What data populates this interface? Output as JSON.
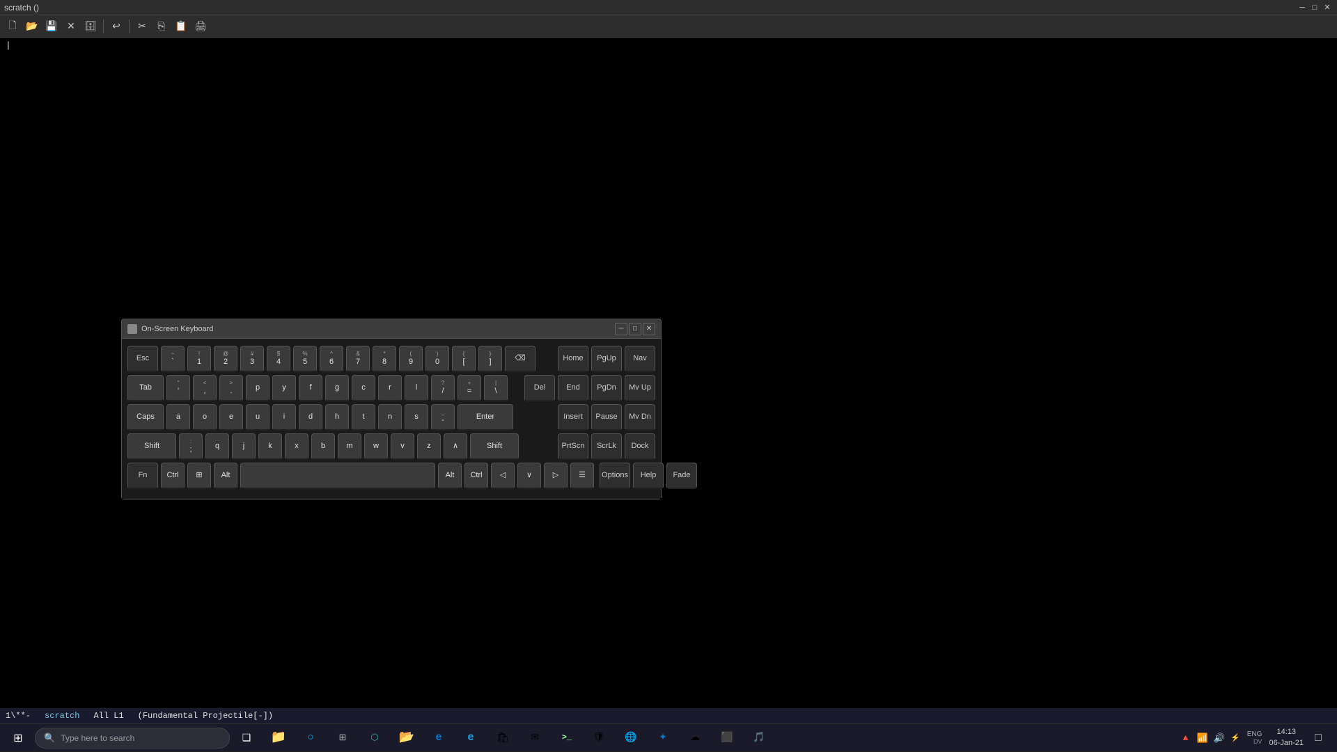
{
  "window": {
    "title": "scratch ()",
    "app_name": "scratch"
  },
  "toolbar": {
    "buttons": [
      {
        "name": "new-file",
        "icon": "🗋",
        "label": "New"
      },
      {
        "name": "open-file",
        "icon": "📂",
        "label": "Open"
      },
      {
        "name": "save-file",
        "icon": "💾",
        "label": "Save"
      },
      {
        "name": "close-file",
        "icon": "✕",
        "label": "Close"
      },
      {
        "name": "save-as",
        "icon": "🗄",
        "label": "Save As"
      },
      {
        "name": "undo",
        "icon": "↩",
        "label": "Undo"
      },
      {
        "name": "cut",
        "icon": "✂",
        "label": "Cut"
      },
      {
        "name": "copy",
        "icon": "⎘",
        "label": "Copy"
      },
      {
        "name": "paste",
        "icon": "📋",
        "label": "Paste"
      },
      {
        "name": "print",
        "icon": "🖨",
        "label": "Print"
      }
    ]
  },
  "osk": {
    "title": "On-Screen Keyboard",
    "rows": [
      {
        "keys": [
          {
            "main": "Esc",
            "top": "",
            "wide": false
          },
          {
            "main": "`",
            "top": "~",
            "wide": false
          },
          {
            "main": "1",
            "top": "!",
            "wide": false
          },
          {
            "main": "2",
            "top": "@",
            "wide": false
          },
          {
            "main": "3",
            "top": "#",
            "wide": false
          },
          {
            "main": "4",
            "top": "$",
            "wide": false
          },
          {
            "main": "5",
            "top": "%",
            "wide": false
          },
          {
            "main": "6",
            "top": "^",
            "wide": false
          },
          {
            "main": "7",
            "top": "&",
            "wide": false
          },
          {
            "main": "8",
            "top": "*",
            "wide": false
          },
          {
            "main": "9",
            "top": "(",
            "wide": false
          },
          {
            "main": "0",
            "top": ")",
            "wide": false
          },
          {
            "main": "[",
            "top": "{",
            "wide": false
          },
          {
            "main": "]",
            "top": "}",
            "wide": false
          },
          {
            "main": "⌫",
            "top": "",
            "wide": true,
            "special": true
          },
          {
            "main": "Home",
            "top": "",
            "wide": false,
            "special": true
          },
          {
            "main": "PgUp",
            "top": "",
            "wide": false,
            "special": true
          },
          {
            "main": "Nav",
            "top": "",
            "wide": false,
            "special": true
          }
        ]
      },
      {
        "keys": [
          {
            "main": "Tab",
            "top": "",
            "wide": true,
            "special": false
          },
          {
            "main": "\"",
            "top": "",
            "wide": false
          },
          {
            "main": "<",
            "top": "",
            "wide": false
          },
          {
            "main": ">",
            "top": "",
            "wide": false
          },
          {
            "main": "p",
            "top": "",
            "wide": false
          },
          {
            "main": "y",
            "top": "",
            "wide": false
          },
          {
            "main": "f",
            "top": "",
            "wide": false
          },
          {
            "main": "g",
            "top": "",
            "wide": false
          },
          {
            "main": "c",
            "top": "",
            "wide": false
          },
          {
            "main": "r",
            "top": "",
            "wide": false
          },
          {
            "main": "l",
            "top": "",
            "wide": false
          },
          {
            "main": "?",
            "top": "",
            "wide": false
          },
          {
            "main": "/",
            "top": "",
            "wide": false
          },
          {
            "main": "+",
            "top": "",
            "wide": false
          },
          {
            "main": "=",
            "top": "",
            "wide": false
          },
          {
            "main": "\\",
            "top": "",
            "wide": false
          },
          {
            "main": "Del",
            "top": "",
            "wide": false,
            "special": true
          },
          {
            "main": "End",
            "top": "",
            "wide": false,
            "special": true
          },
          {
            "main": "PgDn",
            "top": "",
            "wide": false,
            "special": true
          },
          {
            "main": "Mv Up",
            "top": "",
            "wide": false,
            "special": true
          }
        ]
      },
      {
        "keys": [
          {
            "main": "Caps",
            "top": "",
            "wide": true,
            "special": false
          },
          {
            "main": "a",
            "top": "",
            "wide": false
          },
          {
            "main": "o",
            "top": "",
            "wide": false
          },
          {
            "main": "e",
            "top": "",
            "wide": false
          },
          {
            "main": "u",
            "top": "",
            "wide": false
          },
          {
            "main": "i",
            "top": "",
            "wide": false
          },
          {
            "main": "d",
            "top": "",
            "wide": false
          },
          {
            "main": "h",
            "top": "",
            "wide": false
          },
          {
            "main": "t",
            "top": "",
            "wide": false
          },
          {
            "main": "n",
            "top": "",
            "wide": false
          },
          {
            "main": "s",
            "top": "",
            "wide": false
          },
          {
            "main": "_",
            "top": "-",
            "wide": false
          },
          {
            "main": "Enter",
            "top": "",
            "wide": true,
            "special": false
          },
          {
            "main": "Insert",
            "top": "",
            "wide": false,
            "special": true
          },
          {
            "main": "Pause",
            "top": "",
            "wide": false,
            "special": true
          },
          {
            "main": "Mv Dn",
            "top": "",
            "wide": false,
            "special": true
          }
        ]
      },
      {
        "keys": [
          {
            "main": "Shift",
            "top": "",
            "wide": true,
            "special": false
          },
          {
            "main": ";",
            "top": ":",
            "wide": false
          },
          {
            "main": "q",
            "top": "",
            "wide": false
          },
          {
            "main": "j",
            "top": "",
            "wide": false
          },
          {
            "main": "k",
            "top": "",
            "wide": false
          },
          {
            "main": "x",
            "top": "",
            "wide": false
          },
          {
            "main": "b",
            "top": "",
            "wide": false
          },
          {
            "main": "m",
            "top": "",
            "wide": false
          },
          {
            "main": "w",
            "top": "",
            "wide": false
          },
          {
            "main": "v",
            "top": "",
            "wide": false
          },
          {
            "main": "z",
            "top": "",
            "wide": false
          },
          {
            "main": "∧",
            "top": "",
            "wide": false
          },
          {
            "main": "Shift",
            "top": "",
            "wide": true,
            "special": false
          },
          {
            "main": "PrtScn",
            "top": "",
            "wide": false,
            "special": true
          },
          {
            "main": "ScrLk",
            "top": "",
            "wide": false,
            "special": true
          },
          {
            "main": "Dock",
            "top": "",
            "wide": false,
            "special": true
          }
        ]
      },
      {
        "keys": [
          {
            "main": "Fn",
            "top": "",
            "wide": false,
            "special": true
          },
          {
            "main": "Ctrl",
            "top": "",
            "wide": false,
            "special": false
          },
          {
            "main": "⊞",
            "top": "",
            "wide": false
          },
          {
            "main": "Alt",
            "top": "",
            "wide": false
          },
          {
            "main": " ",
            "top": "",
            "space": true
          },
          {
            "main": "Alt",
            "top": "",
            "wide": false
          },
          {
            "main": "Ctrl",
            "top": "",
            "wide": false
          },
          {
            "main": "◁",
            "top": "",
            "wide": false
          },
          {
            "main": "∨",
            "top": "",
            "wide": false
          },
          {
            "main": "▷",
            "top": "",
            "wide": false
          },
          {
            "main": "☰",
            "top": "",
            "wide": false
          },
          {
            "main": "Options",
            "top": "",
            "wide": false,
            "special": true
          },
          {
            "main": "Help",
            "top": "",
            "wide": false,
            "special": true
          },
          {
            "main": "Fade",
            "top": "",
            "wide": false,
            "special": true
          }
        ]
      }
    ]
  },
  "status_bar": {
    "mode": "1\\**-",
    "filename": "scratch",
    "position": "All L1",
    "mode_name": "(Fundamental Projectile[-])"
  },
  "taskbar": {
    "search_placeholder": "Type here to search",
    "clock_time": "14:13",
    "clock_date": "06-Jan-21",
    "locale": "ENG",
    "locale_sub": "DV",
    "apps": [
      {
        "name": "windows-start",
        "icon": "⊞"
      },
      {
        "name": "task-view",
        "icon": "❑"
      },
      {
        "name": "file-explorer",
        "icon": "📁"
      },
      {
        "name": "edge",
        "icon": "e"
      },
      {
        "name": "store",
        "icon": "🏪"
      },
      {
        "name": "mail",
        "icon": "✉"
      },
      {
        "name": "calendar",
        "icon": "📅"
      },
      {
        "name": "terminal",
        "icon": ">_"
      },
      {
        "name": "security",
        "icon": "🛡"
      },
      {
        "name": "browser2",
        "icon": "🌐"
      },
      {
        "name": "vscode",
        "icon": "✦"
      },
      {
        "name": "app2",
        "icon": "☁"
      },
      {
        "name": "app3",
        "icon": "🔵"
      },
      {
        "name": "app4",
        "icon": "📊"
      }
    ]
  }
}
